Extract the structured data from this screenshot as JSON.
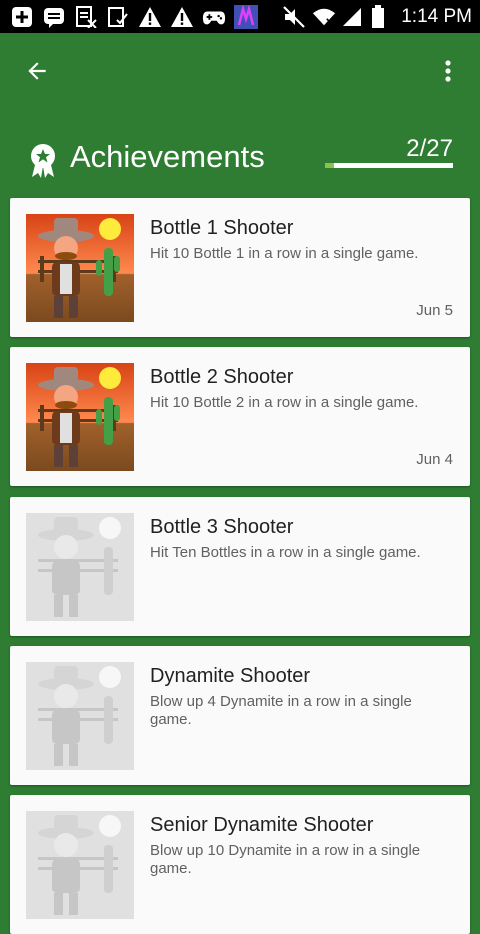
{
  "status_bar": {
    "time": "1:14 PM"
  },
  "app_bar": {
    "back_icon": "arrow-back-icon",
    "menu_icon": "more-vert-icon"
  },
  "header": {
    "title": "Achievements",
    "icon": "award-ribbon-icon",
    "progress_text": "2/27",
    "progress_fraction": 0.074
  },
  "achievements": [
    {
      "title": "Bottle 1 Shooter",
      "description": "Hit 10 Bottle 1 in a row in a single game.",
      "date": "Jun 5",
      "unlocked": true
    },
    {
      "title": "Bottle 2 Shooter",
      "description": "Hit 10 Bottle 2 in a row in a single game.",
      "date": "Jun 4",
      "unlocked": true
    },
    {
      "title": "Bottle 3 Shooter",
      "description": "Hit Ten Bottles in a row in a single game.",
      "date": "",
      "unlocked": false
    },
    {
      "title": "Dynamite Shooter",
      "description": "Blow up 4 Dynamite in a row in a single game.",
      "date": "",
      "unlocked": false
    },
    {
      "title": "Senior Dynamite Shooter",
      "description": "Blow up 10 Dynamite in a row in a single game.",
      "date": "",
      "unlocked": false
    }
  ]
}
